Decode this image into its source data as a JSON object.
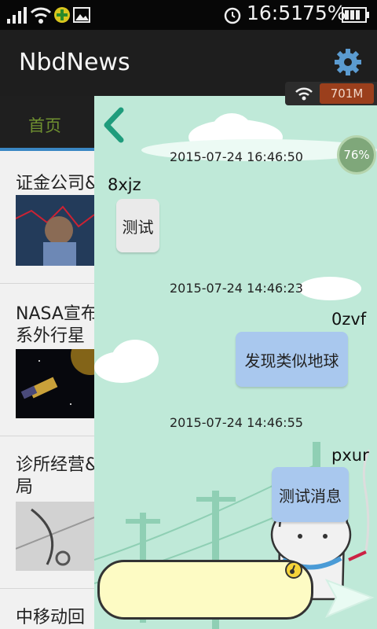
{
  "status_bar": {
    "time": "16:51",
    "battery": "75%"
  },
  "app_bar": {
    "title": "NbdNews",
    "settings_icon": "gear-icon"
  },
  "news_tabs": {
    "home": "首页"
  },
  "news": [
    {
      "title": "证金公司&"
    },
    {
      "title": "NASA宣布",
      "title2": "系外行星"
    },
    {
      "title": "诊所经营&",
      "title2": "局"
    },
    {
      "title": "中移动回"
    }
  ],
  "net_badge": {
    "speed": "701M"
  },
  "memory": {
    "percent": "76%"
  },
  "chat": {
    "partial_timestamp": "2015-07-24 16:46:50",
    "messages": [
      {
        "user": "8xjz",
        "text": "测试",
        "side": "left"
      },
      {
        "timestamp": "2015-07-24 14:46:23",
        "user": "0zvf",
        "text": "发现类似地球",
        "side": "right"
      },
      {
        "timestamp": "2015-07-24 14:46:55",
        "user": "pxur",
        "text": "测试消息",
        "side": "right"
      }
    ]
  },
  "colors": {
    "chat_bg": "#bfe9d8",
    "back_arrow": "#1f9c7c",
    "input_bg": "#fdfbc4"
  }
}
